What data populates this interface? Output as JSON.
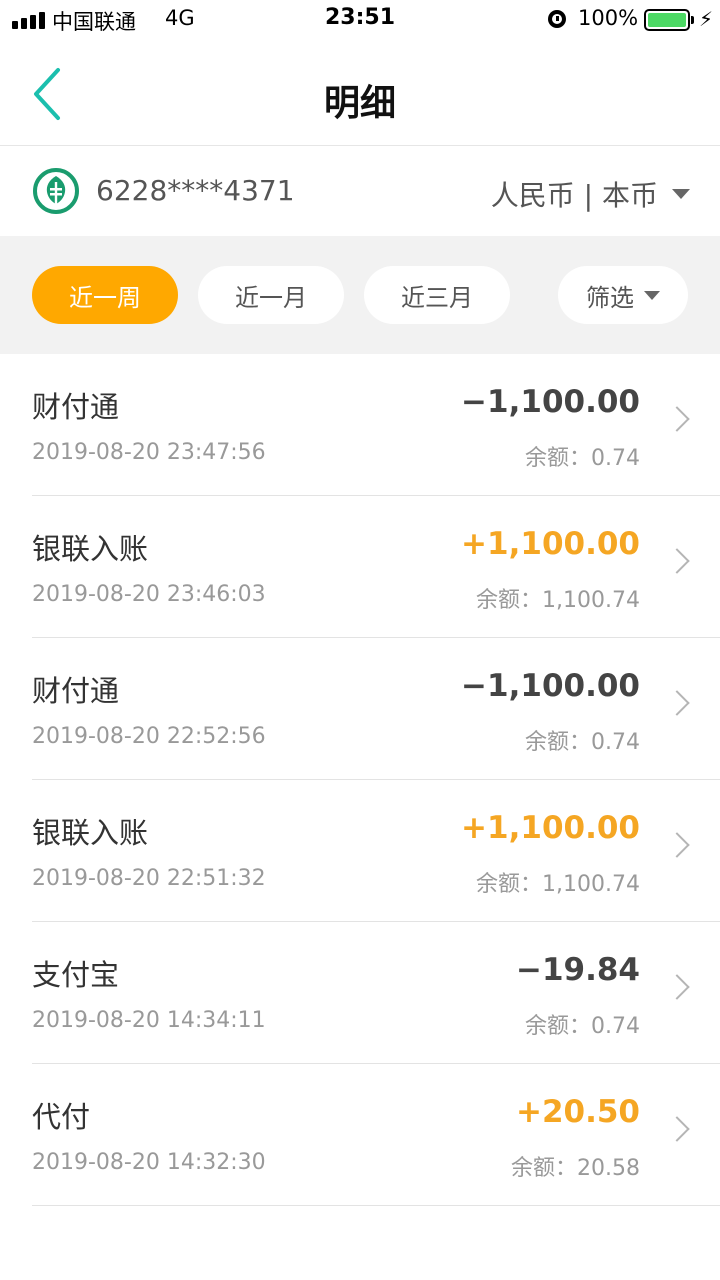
{
  "status_bar": {
    "carrier": "中国联通",
    "network": "4G",
    "time": "23:51",
    "battery": "100%",
    "battery_color": "#4cd964"
  },
  "nav": {
    "title": "明细",
    "back_icon": "chevron-left-icon",
    "accent_color": "#1bbfae"
  },
  "account": {
    "number": "6228****4371",
    "currency": "人民币 | 本币",
    "logo_icon": "bank-logo-icon",
    "logo_color": "#1a9c6e"
  },
  "filters": {
    "active_color": "#ffa800",
    "items": [
      {
        "label": "近一周",
        "active": true
      },
      {
        "label": "近一月",
        "active": false
      },
      {
        "label": "近三月",
        "active": false
      },
      {
        "label": "筛选",
        "active": false
      }
    ]
  },
  "transactions": [
    {
      "title": "财付通",
      "time": "2019-08-20 23:47:56",
      "amount": "−1,100.00",
      "balance": "余额：0.74",
      "type": "expense"
    },
    {
      "title": "银联入账",
      "time": "2019-08-20 23:46:03",
      "amount": "+1,100.00",
      "balance": "余额：1,100.74",
      "type": "income"
    },
    {
      "title": "财付通",
      "time": "2019-08-20 22:52:56",
      "amount": "−1,100.00",
      "balance": "余额：0.74",
      "type": "expense"
    },
    {
      "title": "银联入账",
      "time": "2019-08-20 22:51:32",
      "amount": "+1,100.00",
      "balance": "余额：1,100.74",
      "type": "income"
    },
    {
      "title": "支付宝",
      "time": "2019-08-20 14:34:11",
      "amount": "−19.84",
      "balance": "余额：0.74",
      "type": "expense"
    },
    {
      "title": "代付",
      "time": "2019-08-20 14:32:30",
      "amount": "+20.50",
      "balance": "余额：20.58",
      "type": "income"
    }
  ]
}
